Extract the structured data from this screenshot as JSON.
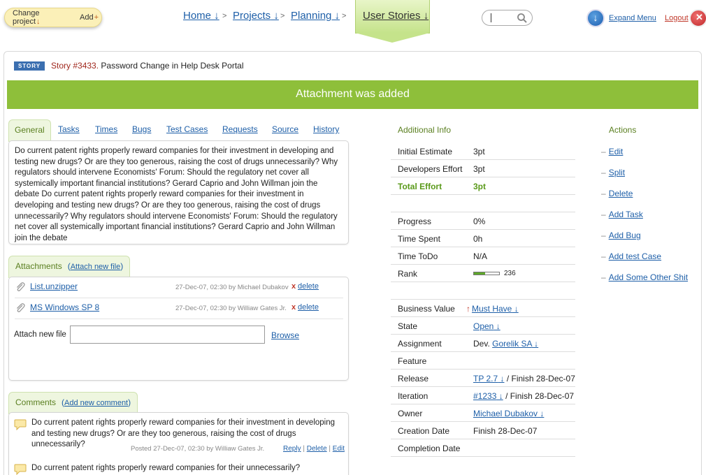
{
  "topbar": {
    "change_project": "Change project",
    "add": "Add",
    "breadcrumbs": [
      "Home",
      "Projects",
      "Planning"
    ],
    "current": "User Stories",
    "expand_menu": "Expand Menu",
    "logout": "Logout"
  },
  "story": {
    "badge": "STORY",
    "id": "Story #3433.",
    "title": "Password Change in Help Desk Portal"
  },
  "alert": "Attachment was added",
  "tabs": [
    "General",
    "Tasks",
    "Times",
    "Bugs",
    "Test Cases",
    "Requests",
    "Source",
    "History"
  ],
  "description": "Do current patent rights properly reward companies for their investment in developing and testing new drugs? Or are they too generous, raising the cost of drugs unnecessarily? Why regulators should intervene Economists' Forum: Should the regulatory net cover all systemically important financial institutions? Gerard Caprio and John Willman join the debate Do current patent rights properly reward companies for their investment in developing and testing new drugs? Or are they too generous, raising the cost of drugs unnecessarily? Why regulators should intervene Economists' Forum: Should the regulatory net cover all systemically important financial institutions? Gerard Caprio and John Willman join the debate",
  "attachments": {
    "title": "Attachments",
    "attach_link": "Attach new file",
    "items": [
      {
        "name": "List.unzipper",
        "meta": "27-Dec-07, 02:30 by Michael Dubakov",
        "x": "x",
        "delete": "delete"
      },
      {
        "name": "MS Windows SP 8",
        "meta": "27-Dec-07, 02:30 by Williaw Gates Jr.",
        "x": "x",
        "delete": "delete"
      }
    ],
    "attach_label": "Attach new file",
    "browse": "Browse"
  },
  "comments": {
    "title": "Comments",
    "add_link": "Add new comment",
    "items": [
      {
        "text": "Do current patent rights properly reward companies for their investment in developing and testing new drugs? Or are they too generous, raising the cost of drugs unnecessarily?",
        "meta": "Posted 27-Dec-07, 02:30 by Williaw Gates Jr.",
        "reply": "Reply",
        "delete": "Delete",
        "edit": "Edit"
      },
      {
        "text": "Do current patent rights properly reward companies for their unnecessarily?"
      }
    ]
  },
  "info": {
    "title": "Additional Info",
    "initial_estimate": {
      "k": "Initial Estimate",
      "v": "3pt"
    },
    "developers_effort": {
      "k": "Developers Effort",
      "v": "3pt"
    },
    "total_effort": {
      "k": "Total Effort",
      "v": "3pt"
    },
    "progress": {
      "k": "Progress",
      "v": "0%"
    },
    "time_spent": {
      "k": "Time Spent",
      "v": "0h"
    },
    "time_todo": {
      "k": "Time ToDo",
      "v": "N/A"
    },
    "rank": {
      "k": "Rank",
      "v": "236",
      "fill_fraction": 0.45
    },
    "business_value": {
      "k": "Business Value",
      "v": "Must Have"
    },
    "state": {
      "k": "State",
      "v": "Open"
    },
    "assignment": {
      "k": "Assignment",
      "prefix": "Dev.",
      "v": "Gorelik SA"
    },
    "feature": {
      "k": "Feature"
    },
    "release": {
      "k": "Release",
      "v": "TP 2.7",
      "suffix": "/ Finish 28-Dec-07"
    },
    "iteration": {
      "k": "Iteration",
      "v": "#1233",
      "suffix": "/ Finish 28-Dec-07"
    },
    "owner": {
      "k": "Owner",
      "v": "Michael Dubakov"
    },
    "creation_date": {
      "k": "Creation Date",
      "v": "Finish 28-Dec-07"
    },
    "completion_date": {
      "k": "Completion Date"
    }
  },
  "actions": {
    "title": "Actions",
    "items": [
      "Edit",
      "Split",
      "Delete",
      "Add Task",
      "Add Bug",
      "Add test Case",
      "Add Some Other Shit"
    ]
  },
  "colors": {
    "accent_green": "#8ebf3a",
    "link_blue": "#1e5fa8",
    "story_id_red": "#a0281e"
  }
}
